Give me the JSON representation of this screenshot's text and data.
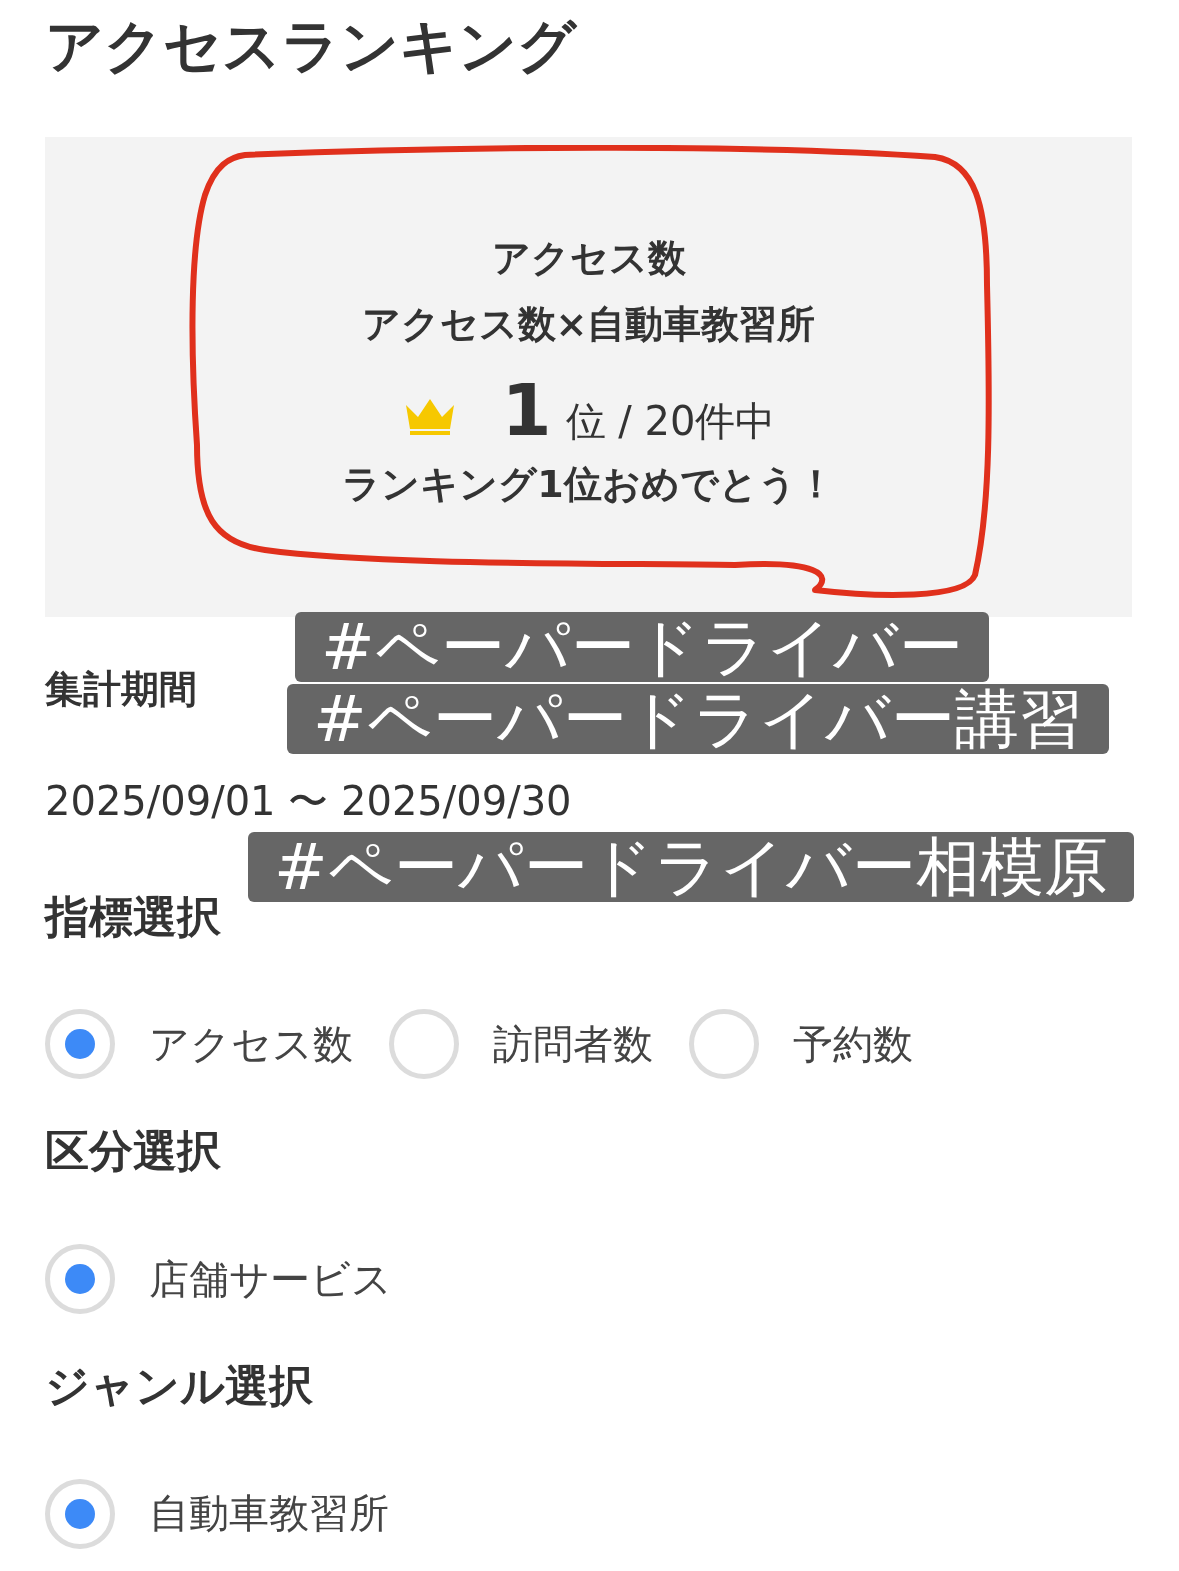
{
  "title": "アクセスランキング",
  "summary": {
    "metric": "アクセス数",
    "segment": "アクセス数×自動車教習所",
    "rank": "1",
    "rank_unit": "位 / 20件中",
    "message": "ランキング1位おめでとう！"
  },
  "period": {
    "label": "集計期間",
    "value": "2025/09/01 〜 2025/09/30"
  },
  "sections": [
    {
      "label": "指標選択",
      "options": [
        {
          "label": "アクセス数",
          "selected": true
        },
        {
          "label": "訪問者数",
          "selected": false
        },
        {
          "label": "予約数",
          "selected": false
        }
      ]
    },
    {
      "label": "区分選択",
      "options": [
        {
          "label": "店舗サービス",
          "selected": true
        }
      ]
    },
    {
      "label": "ジャンル選択",
      "options": [
        {
          "label": "自動車教習所",
          "selected": true
        }
      ]
    }
  ],
  "hashtags": [
    "#ペーパードライバー",
    "#ペーパードライバー講習",
    "#ペーパードライバー相模原"
  ]
}
